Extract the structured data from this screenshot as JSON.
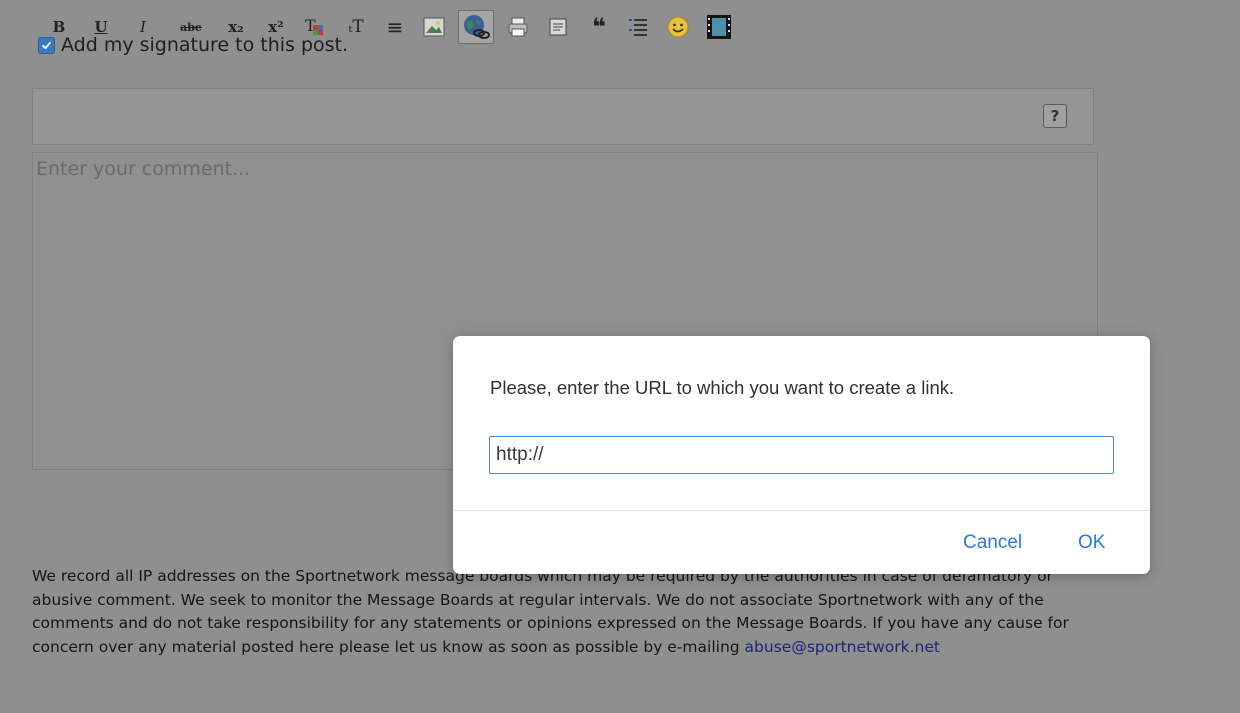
{
  "signature": {
    "label": "Add my signature to this post.",
    "checked": true
  },
  "toolbar": {
    "buttons": [
      {
        "name": "bold-button",
        "glyph": "B",
        "icon": "bold-icon"
      },
      {
        "name": "underline-button",
        "glyph": "U",
        "icon": "underline-icon"
      },
      {
        "name": "italic-button",
        "glyph": "I",
        "icon": "italic-icon"
      },
      {
        "name": "strikethrough-button",
        "glyph": "abe",
        "icon": "strikethrough-icon"
      },
      {
        "name": "subscript-button",
        "glyph": "x₂",
        "icon": "subscript-icon"
      },
      {
        "name": "superscript-button",
        "glyph": "x²",
        "icon": "superscript-icon"
      },
      {
        "name": "text-color-button",
        "glyph": "T",
        "icon": "text-color-icon"
      },
      {
        "name": "font-size-button",
        "glyph": "ₜT",
        "icon": "font-size-icon"
      },
      {
        "name": "align-button",
        "glyph": "≡",
        "icon": "align-icon"
      },
      {
        "name": "image-button",
        "glyph": "",
        "icon": "image-icon"
      },
      {
        "name": "link-button",
        "glyph": "",
        "icon": "globe-link-icon"
      },
      {
        "name": "print-button",
        "glyph": "",
        "icon": "printer-icon"
      },
      {
        "name": "code-button",
        "glyph": "",
        "icon": "code-box-icon"
      },
      {
        "name": "quote-button",
        "glyph": "❝",
        "icon": "quote-icon"
      },
      {
        "name": "list-button",
        "glyph": "",
        "icon": "list-icon"
      },
      {
        "name": "emoji-button",
        "glyph": "",
        "icon": "smiley-icon"
      },
      {
        "name": "video-button",
        "glyph": "",
        "icon": "film-icon"
      }
    ],
    "help_label": "?"
  },
  "comment": {
    "placeholder": "Enter your comment..."
  },
  "disclaimer": {
    "text": "We record all IP addresses on the Sportnetwork message boards which may be required by the authorities in case of defamatory or abusive comment. We seek to monitor the Message Boards at regular intervals. We do not associate Sportnetwork with any of the comments and do not take responsibility for any statements or opinions expressed on the Message Boards. If you have any cause for concern over any material posted here please let us know as soon as possible by e-mailing ",
    "email": "abuse@sportnetwork.net"
  },
  "dialog": {
    "message": "Please, enter the URL to which you want to create a link.",
    "input_value": "http://",
    "cancel_label": "Cancel",
    "ok_label": "OK"
  },
  "colors": {
    "accent": "#2e79d8",
    "checkbox": "#3b79bf",
    "overlay_bg": "#8f8f8f",
    "link": "#1a237a"
  }
}
